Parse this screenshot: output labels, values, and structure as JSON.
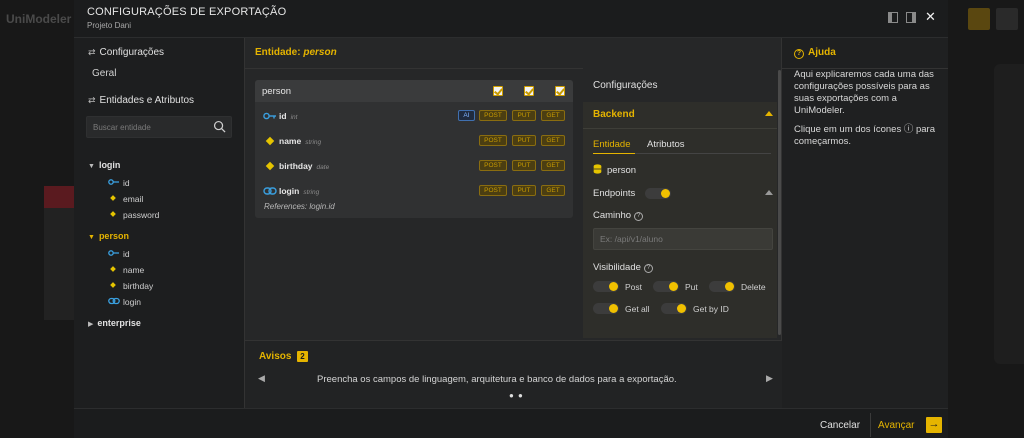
{
  "background": {
    "app_name": "UniModeler"
  },
  "header": {
    "title": "CONFIGURAÇÕES DE EXPORTAÇÃO",
    "subtitle": "Projeto Dani",
    "close_glyph": "✕"
  },
  "sidebar": {
    "config_section": "Configurações",
    "general_item": "Geral",
    "entities_section": "Entidades e Atributos",
    "search_placeholder": "Buscar entidade",
    "entities": [
      {
        "name": "login",
        "attributes": [
          "id",
          "email",
          "password"
        ]
      },
      {
        "name": "person",
        "attributes": [
          "id",
          "name",
          "birthday",
          "login"
        ]
      },
      {
        "name": "enterprise",
        "attributes": []
      }
    ]
  },
  "center": {
    "title_prefix": "Entidade:",
    "title_entity": "person",
    "card": {
      "name": "person",
      "fields": [
        {
          "name": "id",
          "type": "int",
          "badges": [
            "AI",
            "POST",
            "PUT",
            "GET"
          ]
        },
        {
          "name": "name",
          "type": "string",
          "badges": [
            "POST",
            "PUT",
            "GET"
          ]
        },
        {
          "name": "birthday",
          "type": "date",
          "badges": [
            "POST",
            "PUT",
            "GET"
          ]
        },
        {
          "name": "login",
          "type": "string",
          "badges": [
            "POST",
            "PUT",
            "GET"
          ]
        }
      ],
      "references": "References: login.id"
    }
  },
  "config": {
    "heading": "Configurações",
    "backend": {
      "heading": "Backend",
      "tabs": [
        "Entidade",
        "Atributos"
      ],
      "entity_name": "person",
      "endpoints_label": "Endpoints",
      "path_label": "Caminho",
      "path_placeholder": "Ex: /api/v1/aluno",
      "visibility_label": "Visibilidade",
      "toggles": [
        "Post",
        "Put",
        "Delete",
        "Get all",
        "Get by ID"
      ]
    }
  },
  "warnings": {
    "title": "Avisos",
    "count": "2",
    "message": "Preencha os campos de linguagem, arquitetura e banco de dados para a exportação.",
    "dots": "● ●"
  },
  "help": {
    "title": "Ajuda",
    "p1": "Aqui explicaremos cada uma das configurações possíveis para as suas exportações com a UniModeler.",
    "p2": "Clique em um dos ícones ⓘ para começarmos."
  },
  "footer": {
    "cancel": "Cancelar",
    "next": "Avançar",
    "next_glyph": "→"
  },
  "colors": {
    "accent": "#e5b400",
    "key_icon": "#3aa0e0",
    "bg": "#1f2021"
  }
}
